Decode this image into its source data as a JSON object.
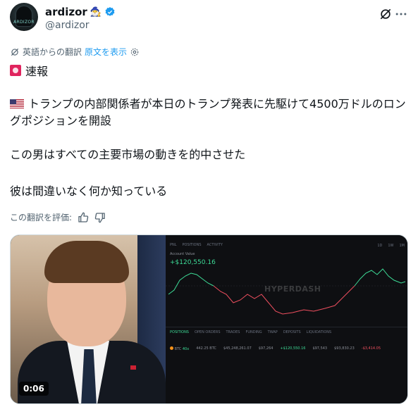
{
  "author": {
    "display_name": "ardizor",
    "emoji_badge": "🧙‍♂️",
    "handle": "@ardizor",
    "avatar_text": "ARDIZOR"
  },
  "translate": {
    "note": "英語からの翻訳",
    "show_original": "原文を表示"
  },
  "post": {
    "breaking": "速報",
    "paragraph_1": "トランプの内部関係者が本日のトランプ発表に先駆けて4500万ドルのロングポジションを開設",
    "paragraph_2": "この男はすべての主要市場の動きを的中させた",
    "paragraph_3": "彼は間違いなく何か知っている"
  },
  "rate": {
    "label": "この翻訳を評価:"
  },
  "media": {
    "duration": "0:06",
    "dashboard": {
      "tabs": [
        "PNL",
        "POSITIONS",
        "ACTIVITY"
      ],
      "timeframes": [
        "1D",
        "1W",
        "1M"
      ],
      "value_label": "Account Value",
      "value": "+$120,550.16",
      "watermark": "HYPERDASH",
      "bottom_tabs": [
        "POSITIONS",
        "OPEN ORDERS",
        "TRADES",
        "FUNDING",
        "TWAP",
        "DEPOSITS",
        "LIQUIDATIONS"
      ],
      "position_row": {
        "coin": "BTC",
        "leverage": "40x",
        "size": "442.25 BTC",
        "value": "$45,248,261.07",
        "entry": "$97,264",
        "pnl": "+$120,550.16",
        "mark": "$97,543",
        "liq": "$93,830.23",
        "funding": "-$3,414.05"
      }
    }
  },
  "colors": {
    "accent": "#1d9bf0",
    "verified": "#1d9bf0",
    "chart_green": "#3ddc97",
    "chart_red": "#ef4f5f"
  }
}
